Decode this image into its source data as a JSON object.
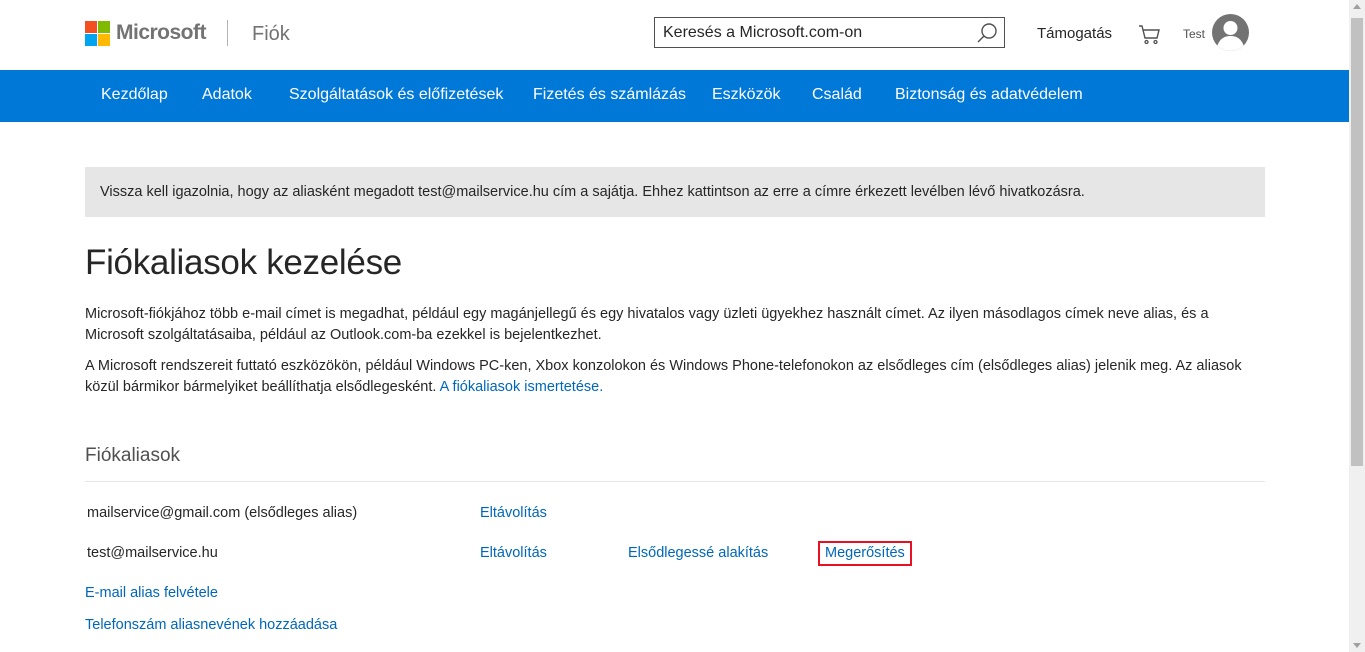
{
  "header": {
    "brand": "Microsoft",
    "section": "Fiók",
    "search_placeholder": "Keresés a Microsoft.com-on",
    "support": "Támogatás",
    "user": "Test"
  },
  "nav": {
    "items": [
      "Kezdőlap",
      "Adatok",
      "Szolgáltatások és előfizetések",
      "Fizetés és számlázás",
      "Eszközök",
      "Család",
      "Biztonság és adatvédelem"
    ]
  },
  "notice": "Vissza kell igazolnia, hogy az aliasként megadott test@mailservice.hu cím a sajátja. Ehhez kattintson az erre a címre érkezett levélben lévő hivatkozásra.",
  "page": {
    "title": "Fiókaliasok kezelése",
    "para1": "Microsoft-fiókjához több e-mail címet is megadhat, például egy magánjellegű és egy hivatalos vagy üzleti ügyekhez használt címet. Az ilyen másodlagos címek neve alias, és a Microsoft szolgáltatásaiba, például az Outlook.com-ba ezekkel is bejelentkezhet.",
    "para2": "A Microsoft rendszereit futtató eszközökön, például Windows PC-ken, Xbox konzolokon és Windows Phone-telefonokon az elsődleges cím (elsődleges alias) jelenik meg. Az aliasok közül bármikor bármelyiket beállíthatja elsődlegesként.",
    "para2_link": "A fiókaliasok ismertetése."
  },
  "aliases": {
    "section_title": "Fiókaliasok",
    "rows": [
      {
        "address": "mailservice@gmail.com (elsődleges alias)",
        "remove": "Eltávolítás"
      },
      {
        "address": "test@mailservice.hu",
        "remove": "Eltávolítás",
        "make_primary": "Elsődlegessé alakítás",
        "verify": "Megerősítés"
      }
    ],
    "add_email": "E-mail alias felvétele",
    "add_phone": "Telefonszám aliasnevének hozzáadása"
  },
  "colors": {
    "nav_background": "#0078d7",
    "link": "#0067b8",
    "highlight_border": "#e81123"
  }
}
